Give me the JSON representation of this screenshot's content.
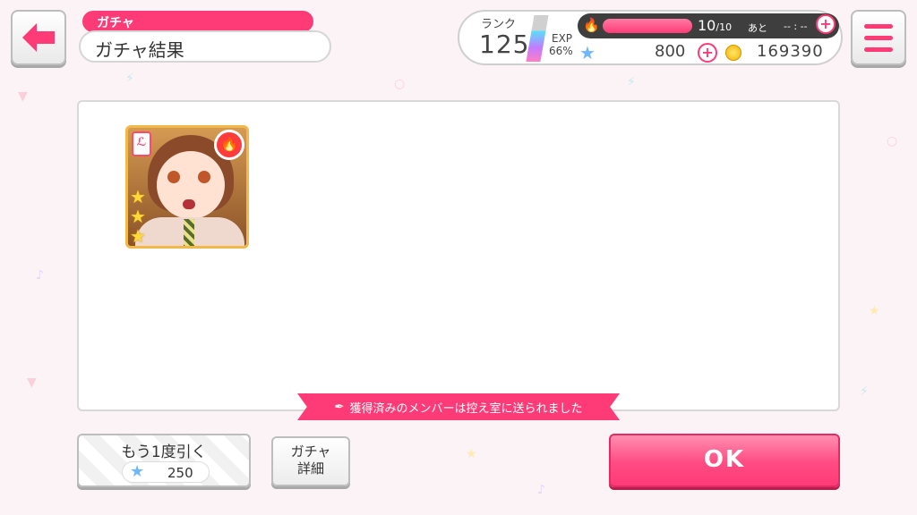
{
  "header": {
    "category": "ガチャ",
    "title": "ガチャ結果"
  },
  "status": {
    "rank_label": "ランク",
    "rank": "125",
    "exp_label": "EXP",
    "exp_percent": "66%",
    "exp_progress": 0.66,
    "stamina_current": "10",
    "stamina_max": "/10",
    "stamina_progress": 1.0,
    "stamina_after_label": "あと",
    "stamina_timer": "-- : --",
    "star_gems": "800",
    "coins": "169390"
  },
  "result": {
    "cards": [
      {
        "rarity_stars": 3,
        "attribute": "powerful",
        "band_icon": "band-icon"
      }
    ]
  },
  "notice": "獲得済みのメンバーは控え室に送られました",
  "buttons": {
    "pull_again": "もう1度引く",
    "pull_cost": "250",
    "gacha_detail_line1": "ガチャ",
    "gacha_detail_line2": "詳細",
    "ok": "OK"
  },
  "colors": {
    "accent": "#ff3b77",
    "star": "#6fb8ff",
    "coin": "#f2b300"
  }
}
